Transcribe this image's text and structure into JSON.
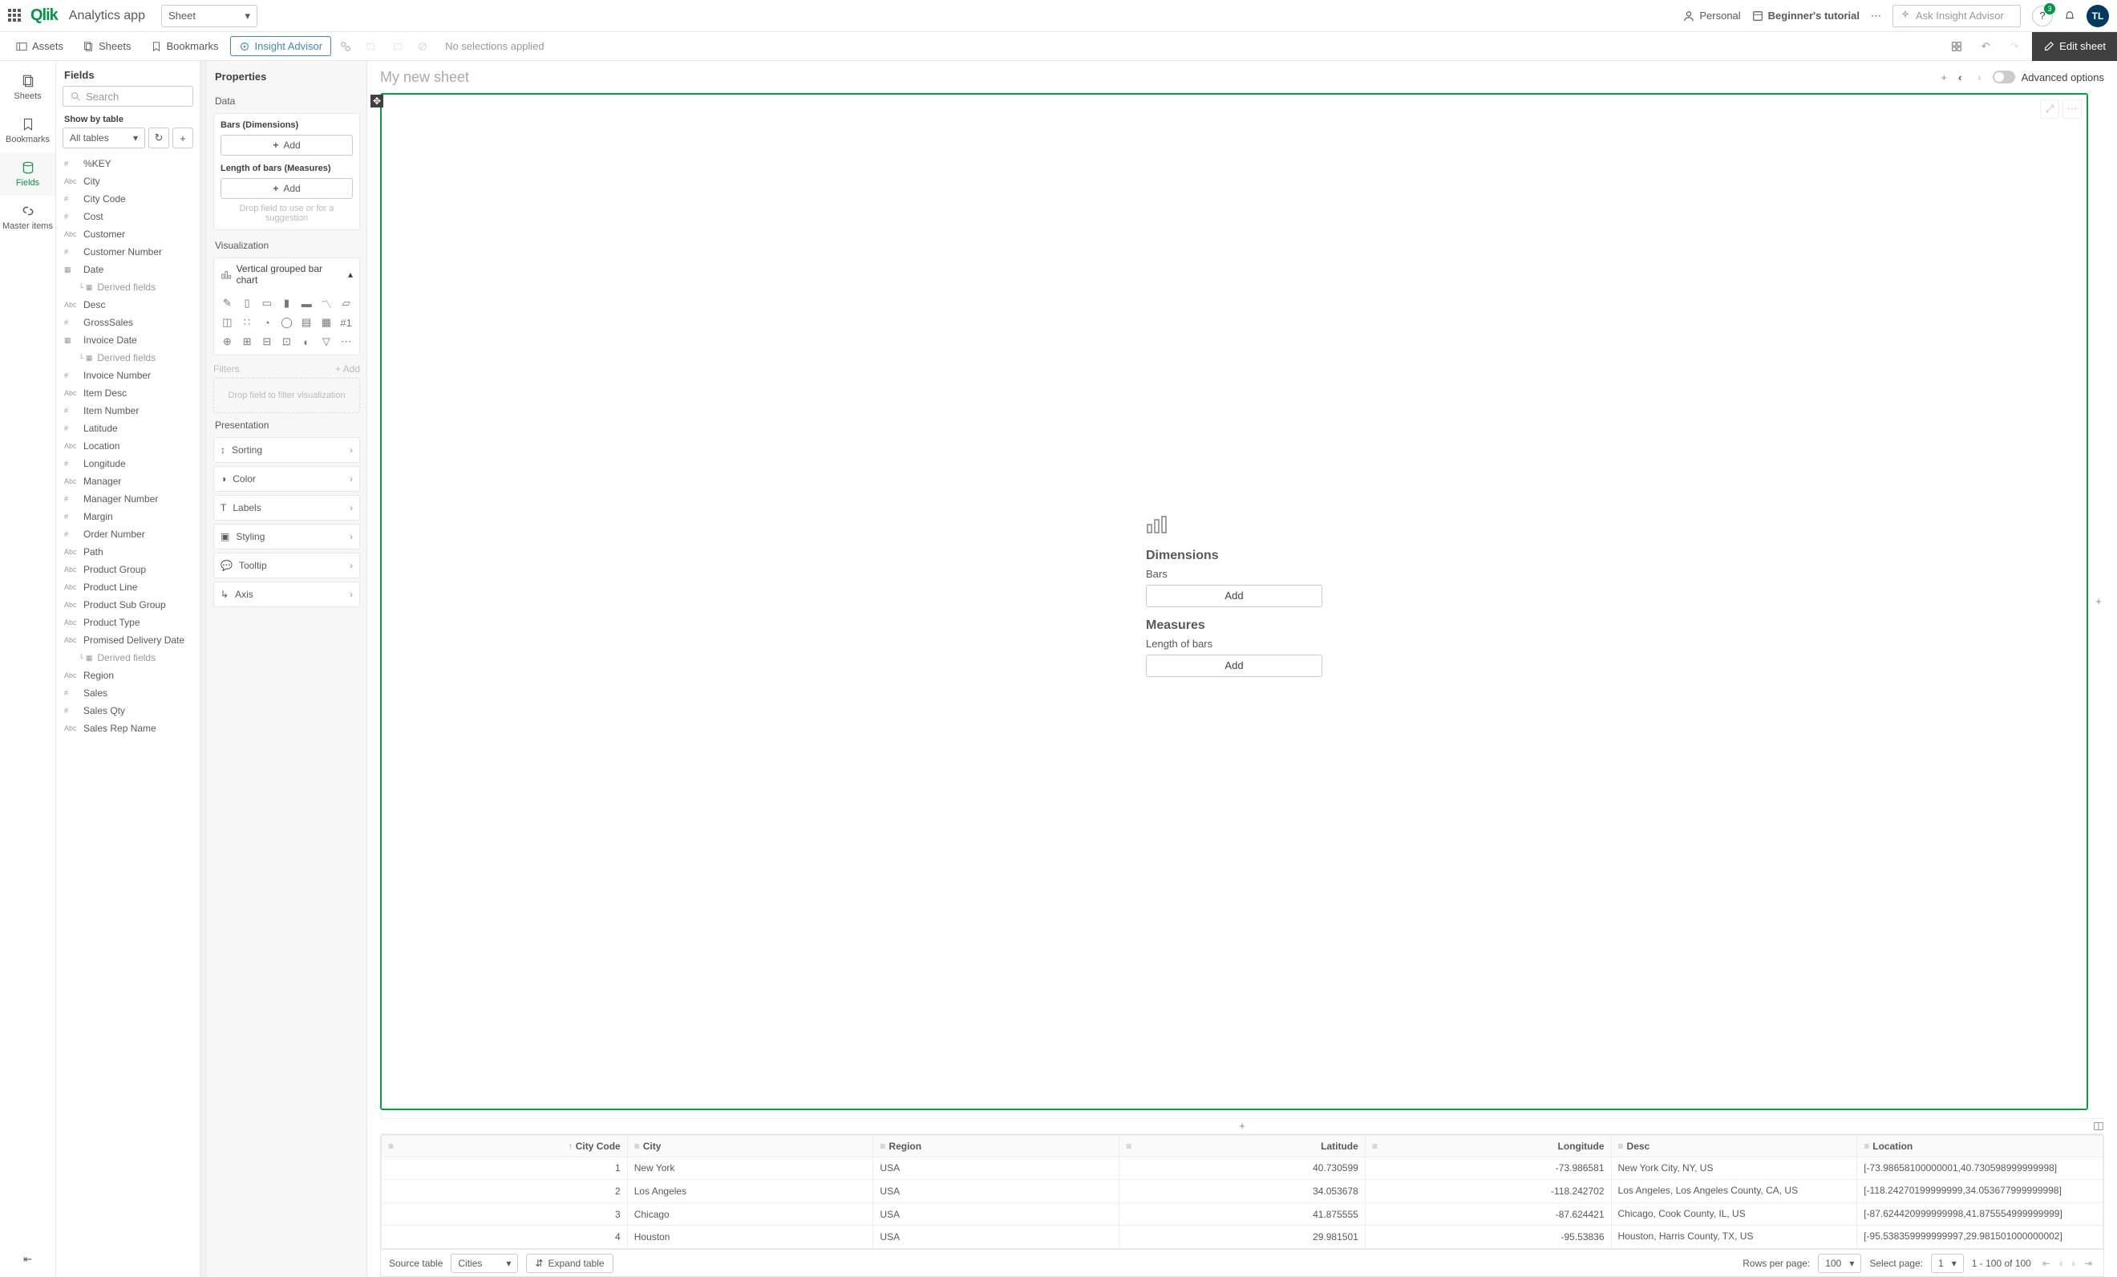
{
  "topbar": {
    "brand": "Qlik",
    "app_name": "Analytics app",
    "sheet_dd": "Sheet",
    "personal": "Personal",
    "tutorial": "Beginner's tutorial",
    "ask_placeholder": "Ask Insight Advisor",
    "notif_count": "3",
    "avatar": "TL"
  },
  "toolbar": {
    "assets": "Assets",
    "sheets": "Sheets",
    "bookmarks": "Bookmarks",
    "insight": "Insight Advisor",
    "nosel": "No selections applied",
    "edit": "Edit sheet"
  },
  "sidenav": {
    "sheets": "Sheets",
    "bookmarks": "Bookmarks",
    "fields": "Fields",
    "master": "Master items"
  },
  "fields": {
    "title": "Fields",
    "search_ph": "Search",
    "show_by": "Show by table",
    "alltables": "All tables",
    "list": [
      {
        "t": "#",
        "n": "%KEY"
      },
      {
        "t": "Abc",
        "n": "City"
      },
      {
        "t": "#",
        "n": "City Code"
      },
      {
        "t": "#",
        "n": "Cost"
      },
      {
        "t": "Abc",
        "n": "Customer"
      },
      {
        "t": "#",
        "n": "Customer Number"
      },
      {
        "t": "",
        "n": "Date",
        "date": true
      },
      {
        "t": "",
        "n": "Derived fields",
        "der": true
      },
      {
        "t": "Abc",
        "n": "Desc"
      },
      {
        "t": "#",
        "n": "GrossSales"
      },
      {
        "t": "",
        "n": "Invoice Date",
        "date": true
      },
      {
        "t": "",
        "n": "Derived fields",
        "der": true
      },
      {
        "t": "#",
        "n": "Invoice Number"
      },
      {
        "t": "Abc",
        "n": "Item Desc"
      },
      {
        "t": "#",
        "n": "Item Number"
      },
      {
        "t": "#",
        "n": "Latitude"
      },
      {
        "t": "Abc",
        "n": "Location"
      },
      {
        "t": "#",
        "n": "Longitude"
      },
      {
        "t": "Abc",
        "n": "Manager"
      },
      {
        "t": "#",
        "n": "Manager Number"
      },
      {
        "t": "#",
        "n": "Margin"
      },
      {
        "t": "#",
        "n": "Order Number"
      },
      {
        "t": "Abc",
        "n": "Path"
      },
      {
        "t": "Abc",
        "n": "Product Group"
      },
      {
        "t": "Abc",
        "n": "Product Line"
      },
      {
        "t": "Abc",
        "n": "Product Sub Group"
      },
      {
        "t": "Abc",
        "n": "Product Type"
      },
      {
        "t": "Abc",
        "n": "Promised Delivery Date"
      },
      {
        "t": "",
        "n": "Derived fields",
        "der": true
      },
      {
        "t": "Abc",
        "n": "Region"
      },
      {
        "t": "#",
        "n": "Sales"
      },
      {
        "t": "#",
        "n": "Sales Qty"
      },
      {
        "t": "Abc",
        "n": "Sales Rep Name"
      }
    ]
  },
  "props": {
    "title": "Properties",
    "data": "Data",
    "bars": "Bars (Dimensions)",
    "len": "Length of bars (Measures)",
    "add": "Add",
    "hint": "Drop field to use or for a suggestion",
    "viz": "Visualization",
    "viz_sel": "Vertical grouped bar chart",
    "filters": "Filters",
    "filt_add": "+ Add",
    "filt_hint": "Drop field to filter visualization",
    "presentation": "Presentation",
    "pres_items": [
      "Sorting",
      "Color",
      "Labels",
      "Styling",
      "Tooltip",
      "Axis"
    ]
  },
  "canvas": {
    "title": "My new sheet",
    "adv": "Advanced options",
    "dimensions": "Dimensions",
    "bars": "Bars",
    "measures": "Measures",
    "len": "Length of bars",
    "add": "Add"
  },
  "table": {
    "cols": [
      "City Code",
      "City",
      "Region",
      "Latitude",
      "Longitude",
      "Desc",
      "Location"
    ],
    "rows": [
      {
        "n": "1",
        "code": "",
        "city": "New York",
        "region": "USA",
        "lat": "40.730599",
        "lon": "-73.986581",
        "desc": "New York City, NY, US",
        "loc": "[-73.98658100000001,40.730598999999998]"
      },
      {
        "n": "2",
        "code": "",
        "city": "Los Angeles",
        "region": "USA",
        "lat": "34.053678",
        "lon": "-118.242702",
        "desc": "Los Angeles, Los Angeles County, CA, US",
        "loc": "[-118.24270199999999,34.053677999999998]"
      },
      {
        "n": "3",
        "code": "",
        "city": "Chicago",
        "region": "USA",
        "lat": "41.875555",
        "lon": "-87.624421",
        "desc": "Chicago, Cook County, IL, US",
        "loc": "[-87.624420999999998,41.875554999999999]"
      },
      {
        "n": "4",
        "code": "",
        "city": "Houston",
        "region": "USA",
        "lat": "29.981501",
        "lon": "-95.53836",
        "desc": "Houston, Harris County, TX, US",
        "loc": "[-95.538359999999997,29.981501000000002]"
      }
    ],
    "source": "Source table",
    "source_val": "Cities",
    "expand": "Expand table",
    "rpp": "Rows per page:",
    "rpp_val": "100",
    "selpage": "Select page:",
    "selpage_val": "1",
    "range": "1 - 100 of 100"
  }
}
